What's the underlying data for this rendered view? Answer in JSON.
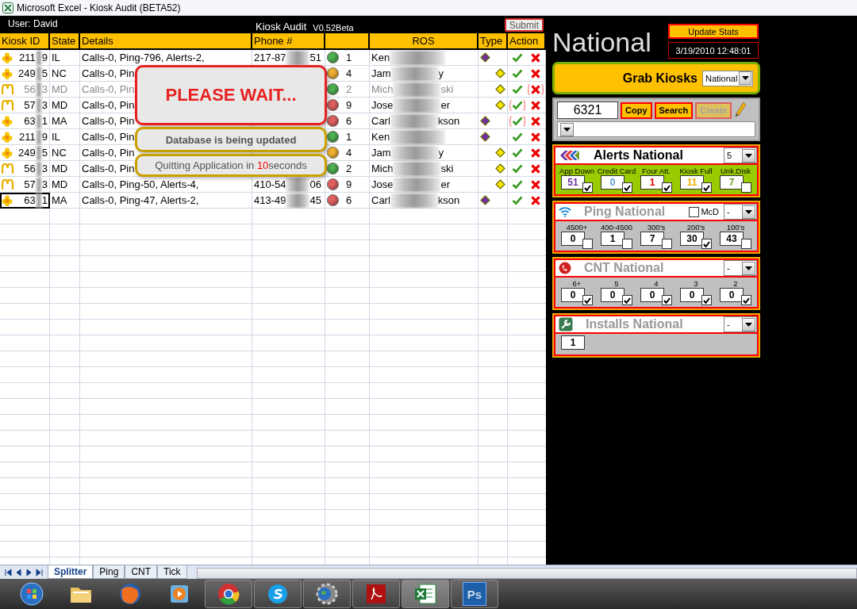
{
  "window": {
    "title": "Microsoft Excel - Kiosk Audit (BETA52)"
  },
  "header": {
    "user": "User: David",
    "app_title": "Kiosk Audit",
    "version": "V0.52Beta",
    "submit": "Submit"
  },
  "table": {
    "columns": [
      {
        "label": "Kiosk ID"
      },
      {
        "label": "State"
      },
      {
        "label": "Details"
      },
      {
        "label": "Phone #"
      },
      {
        "kind": "status"
      },
      {
        "label": "ROS",
        "kind": "centered"
      },
      {
        "label": "Type"
      },
      {
        "label": "Action"
      }
    ],
    "rows": [
      {
        "kind": "flower",
        "id": "211",
        "id_end": "9",
        "state": "IL",
        "details": "Calls-0, Ping-796, Alerts-2,",
        "phone": "217-87",
        "phone_end": "51",
        "status": {
          "color": "#4caf50",
          "count": "1"
        },
        "ros": "Ken",
        "type": {
          "kind": "primary",
          "color": "#7030a0"
        },
        "check_flag": false,
        "x_flag": false,
        "dimmed": false,
        "selected": false
      },
      {
        "kind": "flower",
        "id": "249",
        "id_end": "5",
        "state": "NC",
        "details": "Calls-0, Pin",
        "status": {
          "color": "#f0b030",
          "count": "4"
        },
        "ros": "Jam",
        "ros_end": "y",
        "type": {
          "kind": "secondary",
          "color": "#f5e600"
        },
        "check_flag": false,
        "x_flag": false,
        "dimmed": false,
        "selected": false
      },
      {
        "kind": "arch",
        "id": "56",
        "id_end": "3",
        "state": "MD",
        "details": "Calls-0, Pin",
        "status": {
          "color": "#4caf50",
          "count": "2"
        },
        "ros": "Mich",
        "ros_end": "ski",
        "type": {
          "kind": "secondary",
          "color": "#f5e600"
        },
        "check_flag": false,
        "x_flag": true,
        "dimmed": true,
        "selected": false
      },
      {
        "kind": "arch",
        "id": "57",
        "id_end": "3",
        "state": "MD",
        "details": "Calls-0, Pin",
        "status": {
          "color": "#e06060",
          "count": "9"
        },
        "ros": "Jose",
        "ros_end": "er",
        "type": {
          "kind": "secondary",
          "color": "#f5e600"
        },
        "check_flag": true,
        "x_flag": false,
        "dimmed": false,
        "selected": false
      },
      {
        "kind": "flower",
        "id": "63",
        "id_end": "1",
        "state": "MA",
        "details": "Calls-0, Pin",
        "status": {
          "color": "#e06060",
          "count": "6"
        },
        "ros": "Carl",
        "ros_end": "kson",
        "type": {
          "kind": "primary",
          "color": "#7030a0"
        },
        "check_flag": true,
        "x_flag": false,
        "dimmed": false,
        "selected": false
      },
      {
        "kind": "flower",
        "id": "211",
        "id_end": "9",
        "state": "IL",
        "details": "Calls-0, Pin",
        "status": {
          "color": "#4caf50",
          "count": "1"
        },
        "ros": "Ken",
        "type": {
          "kind": "primary",
          "color": "#7030a0"
        },
        "check_flag": false,
        "x_flag": false,
        "dimmed": false,
        "selected": false
      },
      {
        "kind": "flower",
        "id": "249",
        "id_end": "5",
        "state": "NC",
        "details": "Calls-0, Pin",
        "status": {
          "color": "#f0b030",
          "count": "4"
        },
        "ros": "Jam",
        "ros_end": "y",
        "type": {
          "kind": "secondary",
          "color": "#f5e600"
        },
        "check_flag": false,
        "x_flag": false,
        "dimmed": false,
        "selected": false
      },
      {
        "kind": "arch",
        "id": "56",
        "id_end": "3",
        "state": "MD",
        "details": "Calls-0, Pin",
        "status": {
          "color": "#4caf50",
          "count": "2"
        },
        "ros": "Mich",
        "ros_end": "ski",
        "type": {
          "kind": "secondary",
          "color": "#f5e600"
        },
        "check_flag": false,
        "x_flag": false,
        "dimmed": false,
        "selected": false
      },
      {
        "kind": "arch",
        "id": "57",
        "id_end": "3",
        "state": "MD",
        "details": "Calls-0, Ping-50, Alerts-4,",
        "phone": "410-54",
        "phone_end": "06",
        "status": {
          "color": "#e06060",
          "count": "9"
        },
        "ros": "Jose",
        "ros_end": "er",
        "type": {
          "kind": "secondary",
          "color": "#f5e600"
        },
        "check_flag": false,
        "x_flag": false,
        "dimmed": false,
        "selected": false
      },
      {
        "kind": "flower",
        "id": "63",
        "id_end": "1",
        "state": "MA",
        "details": "Calls-0, Ping-47, Alerts-2,",
        "phone": "413-49",
        "phone_end": "45",
        "status": {
          "color": "#e06060",
          "count": "6"
        },
        "ros": "Carl",
        "ros_end": "kson",
        "type": {
          "kind": "primary",
          "color": "#7030a0"
        },
        "check_flag": false,
        "x_flag": false,
        "dimmed": false,
        "selected": true
      }
    ]
  },
  "popups": [
    {
      "kind": "wait",
      "text": "PLEASE WAIT..."
    },
    {
      "kind": "info",
      "text": "Database is being updated"
    },
    {
      "kind": "countdown",
      "before": "Quitting Application in ",
      "count": "10",
      "after": "seconds"
    }
  ],
  "panel": {
    "title": "National",
    "update_button": "Update Stats",
    "timestamp": "3/19/2010 12:48:01",
    "grab": {
      "label": "Grab Kiosks",
      "value": "National"
    },
    "search": {
      "value": "6321",
      "buttons": [
        {
          "label": "Copy",
          "disabled": false
        },
        {
          "label": "Search",
          "disabled": false
        },
        {
          "label": "Create",
          "disabled": true
        }
      ]
    },
    "sections": [
      {
        "kind": "alerts",
        "title": "Alerts National",
        "active": true,
        "filter": "5",
        "metrics": [
          {
            "label": "App Down",
            "value": "51",
            "color": "#7030a0",
            "checked": true
          },
          {
            "label": "Credit Card",
            "value": "0",
            "color": "#5b9bd5",
            "checked": true
          },
          {
            "label": "Four Att.",
            "value": "1",
            "color": "#e00000",
            "checked": true
          },
          {
            "label": "Kiosk Full",
            "value": "11",
            "color": "#f0b000",
            "checked": true
          },
          {
            "label": "Unk.Disk",
            "value": "7",
            "color": "#70a030",
            "checked": false
          }
        ]
      },
      {
        "kind": "ping",
        "title": "Ping National",
        "active": false,
        "option": {
          "label": "McD",
          "checked": false
        },
        "filter": "-",
        "metrics": [
          {
            "label": "4500+",
            "value": "0",
            "checked": false
          },
          {
            "label": "400-4500",
            "value": "1",
            "checked": false
          },
          {
            "label": "300's",
            "value": "7",
            "checked": false
          },
          {
            "label": "200's",
            "value": "30",
            "checked": true
          },
          {
            "label": "100's",
            "value": "43",
            "checked": false
          }
        ]
      },
      {
        "kind": "cnt",
        "title": "CNT National",
        "active": false,
        "filter": "-",
        "metrics": [
          {
            "label": "6+",
            "value": "0",
            "checked": true
          },
          {
            "label": "5",
            "value": "0",
            "checked": true
          },
          {
            "label": "4",
            "value": "0",
            "checked": true
          },
          {
            "label": "3",
            "value": "0",
            "checked": true
          },
          {
            "label": "2",
            "value": "0",
            "checked": true
          }
        ]
      },
      {
        "kind": "installs",
        "title": "Installs National",
        "active": false,
        "filter": "-",
        "metrics": [
          {
            "value": "1"
          }
        ]
      }
    ]
  },
  "sheet_tabs": [
    {
      "label": "Splitter",
      "selected": true
    },
    {
      "label": "Ping",
      "selected": false
    },
    {
      "label": "CNT",
      "selected": false
    },
    {
      "label": "Tick",
      "selected": false
    }
  ],
  "taskbar": [
    {
      "kind": "start",
      "running": false,
      "active": false
    },
    {
      "kind": "folder",
      "running": false,
      "active": false
    },
    {
      "kind": "globe",
      "running": false,
      "active": false
    },
    {
      "kind": "media",
      "running": false,
      "active": false
    },
    {
      "kind": "ring",
      "running": true,
      "active": false
    },
    {
      "kind": "cloud",
      "running": true,
      "active": false
    },
    {
      "kind": "gear",
      "running": true,
      "active": false
    },
    {
      "kind": "document",
      "running": true,
      "active": false
    },
    {
      "kind": "spreadsheet",
      "running": true,
      "active": true
    },
    {
      "kind": "label",
      "label": "Ps",
      "running": true,
      "active": false
    }
  ]
}
